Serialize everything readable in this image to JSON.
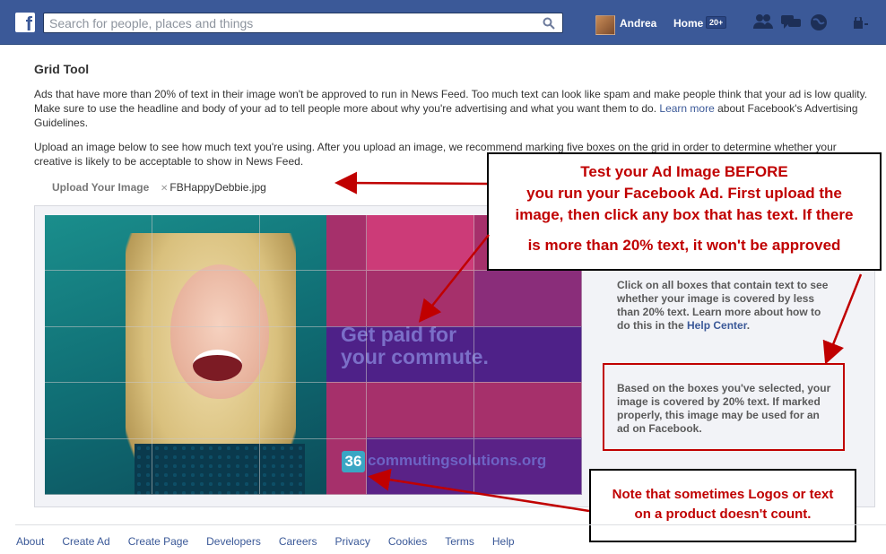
{
  "header": {
    "search_placeholder": "Search for people, places and things",
    "user_name": "Andrea",
    "home_label": "Home",
    "home_badge": "20+"
  },
  "page": {
    "title": "Grid Tool",
    "para1_part1": "Ads that have more than 20% of text in their image won't be approved to run in News Feed. Too much text can look like spam and make people think that your ad is low quality. Make sure to use the headline and body of your ad to tell people more about why you're advertising and what you want them to do.",
    "learn_more": "Learn more",
    "para1_part2": "about Facebook's Advertising Guidelines.",
    "para2": "Upload an image below to see how much text you're using. After you upload an image, we recommend marking five boxes on the grid in order to determine whether your creative is likely to be acceptable to show in News Feed.",
    "upload_label": "Upload Your Image",
    "upload_filename": "FBHappyDebbie.jpg",
    "instructions_part1": "Click on all boxes that contain text to see whether your image is covered by less than 20% text. Learn more about how to do this in the",
    "help_center": "Help Center",
    "instructions_end": ".",
    "result_text": "Based on the boxes you've selected, your image is covered by 20% text. If marked properly, this image may be used for an ad on Facebook."
  },
  "ad_image": {
    "headline_line1": "Get paid for",
    "headline_line2": "your commute.",
    "logo_number": "36",
    "logo_text": "commutingsolutions.org"
  },
  "annotations": {
    "callout1_line1": "Test your Ad Image BEFORE",
    "callout1_line2": "you run your Facebook Ad.  First upload the",
    "callout1_line3": "image, then click any box that has text.  If there",
    "callout1_line4": "is more than 20% text, it won't be approved",
    "callout2_line1": "Note that sometimes Logos or text",
    "callout2_line2": "on a product doesn't count."
  },
  "footer": {
    "links": [
      "About",
      "Create Ad",
      "Create Page",
      "Developers",
      "Careers",
      "Privacy",
      "Cookies",
      "Terms",
      "Help"
    ]
  },
  "colors": {
    "brand": "#3b5998",
    "annotation_red": "#c00000"
  }
}
